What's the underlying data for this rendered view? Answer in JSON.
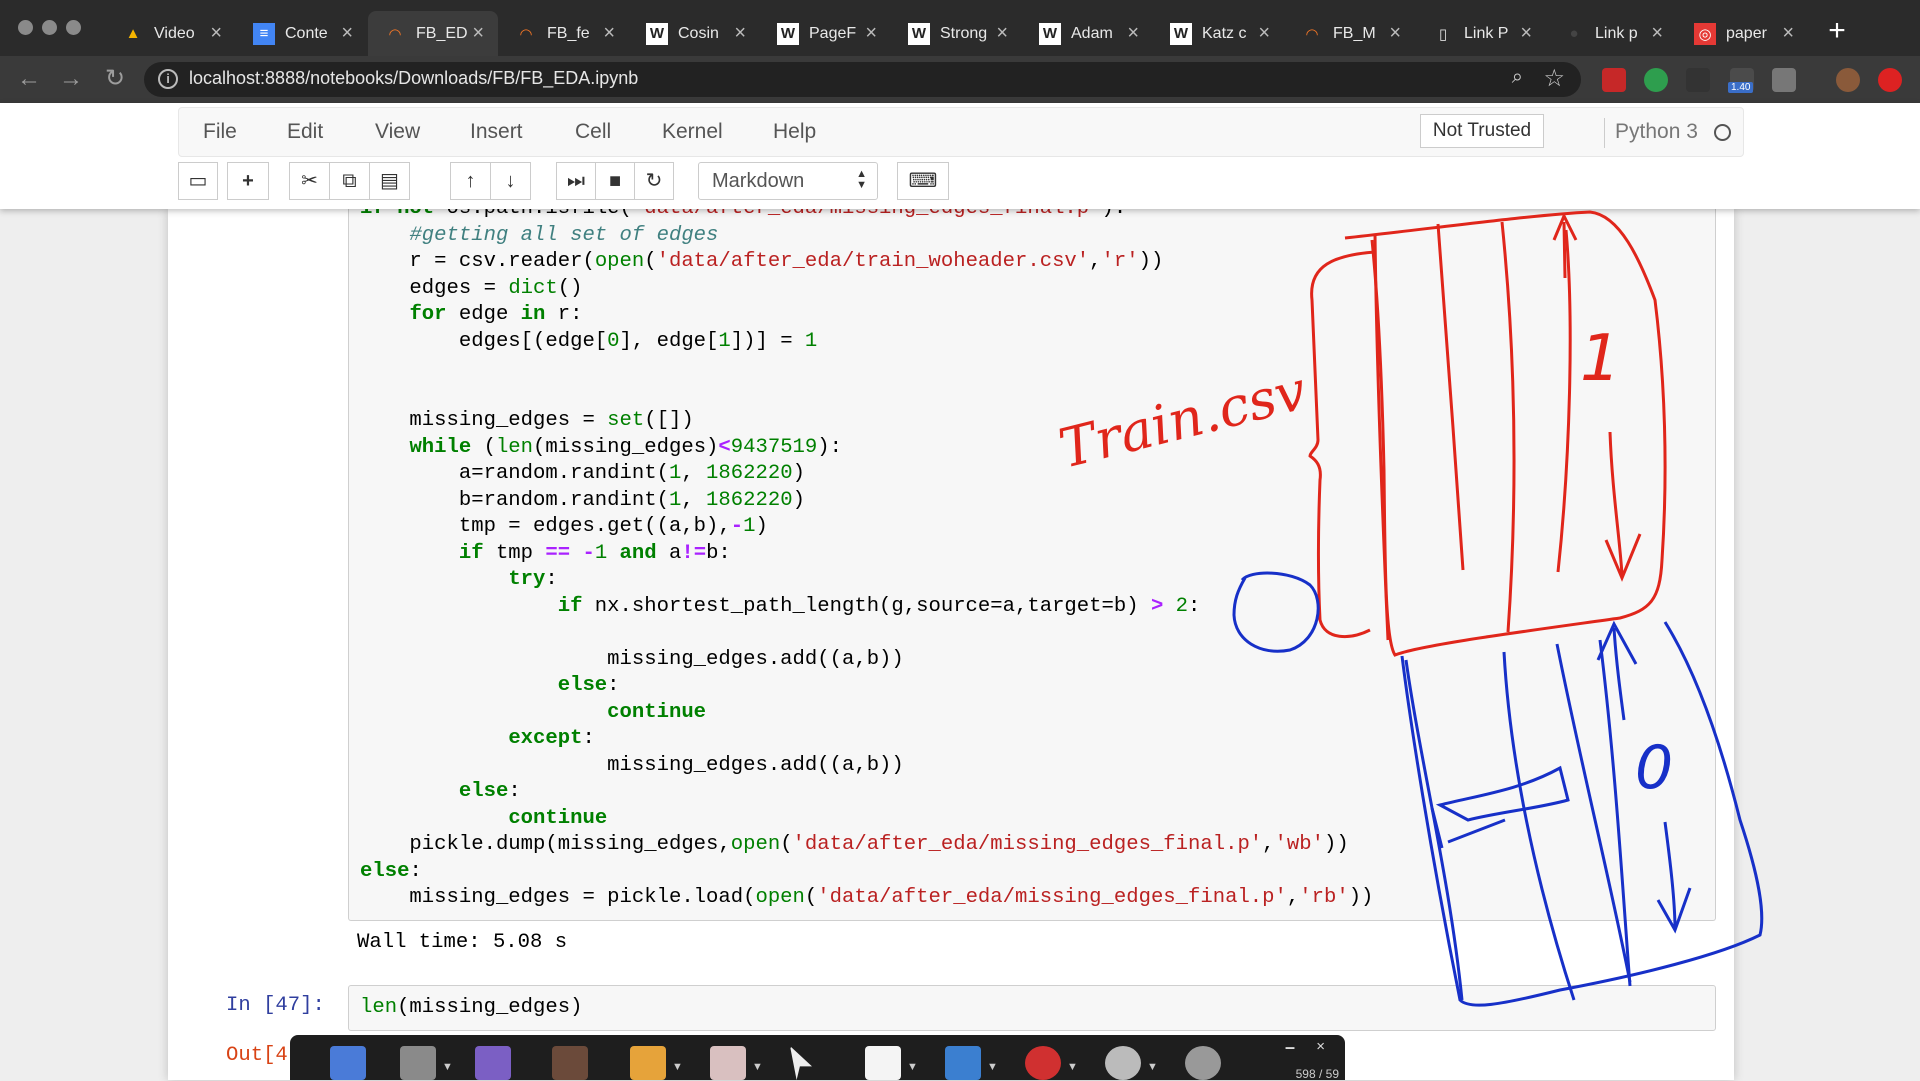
{
  "browser": {
    "tabs": [
      {
        "label": "Video",
        "icon": "google-drive-icon"
      },
      {
        "label": "Conte",
        "icon": "google-docs-icon"
      },
      {
        "label": "FB_ED",
        "icon": "jupyter-icon",
        "active": true
      },
      {
        "label": "FB_fe",
        "icon": "jupyter-icon"
      },
      {
        "label": "Cosin",
        "icon": "wikipedia-icon"
      },
      {
        "label": "PageF",
        "icon": "wikipedia-icon"
      },
      {
        "label": "Strong",
        "icon": "wikipedia-icon"
      },
      {
        "label": "Adam",
        "icon": "wikipedia-icon"
      },
      {
        "label": "Katz c",
        "icon": "wikipedia-icon"
      },
      {
        "label": "FB_M",
        "icon": "jupyter-icon"
      },
      {
        "label": "Link P",
        "icon": "document-icon"
      },
      {
        "label": "Link p",
        "icon": "github-icon"
      },
      {
        "label": "paper",
        "icon": "pdf-icon"
      }
    ],
    "tab_close_glyph": "×",
    "new_tab_glyph": "+",
    "url": "localhost:8888/notebooks/Downloads/FB/FB_EDA.ipynb",
    "extension_badge": "1.40"
  },
  "jupyter": {
    "menu": [
      "File",
      "Edit",
      "View",
      "Insert",
      "Cell",
      "Kernel",
      "Help"
    ],
    "trust_label": "Not Trusted",
    "kernel_name": "Python 3",
    "cell_type": "Markdown",
    "toolbar_icons": [
      "save-icon",
      "add-cell-icon",
      "cut-icon",
      "copy-icon",
      "paste-icon",
      "move-up-icon",
      "move-down-icon",
      "run-icon",
      "stop-icon",
      "restart-icon",
      "command-palette-icon"
    ]
  },
  "cell1": {
    "lines": [
      [
        {
          "t": "if not os.path.isfile(",
          "c": "kw-partial"
        },
        {
          "t": "'data/after_eda/missing_edges_final.p'",
          "c": "str"
        },
        {
          "t": "):",
          "c": ""
        }
      ],
      [
        {
          "t": "    ",
          "c": ""
        },
        {
          "t": "#getting all set of edges",
          "c": "com"
        }
      ],
      [
        {
          "t": "    r = csv.reader(",
          "c": ""
        },
        {
          "t": "open",
          "c": "bi"
        },
        {
          "t": "(",
          "c": ""
        },
        {
          "t": "'data/after_eda/train_woheader.csv'",
          "c": "str"
        },
        {
          "t": ",",
          "c": ""
        },
        {
          "t": "'r'",
          "c": "str"
        },
        {
          "t": "))",
          "c": ""
        }
      ],
      [
        {
          "t": "    edges = ",
          "c": ""
        },
        {
          "t": "dict",
          "c": "bi"
        },
        {
          "t": "()",
          "c": ""
        }
      ],
      [
        {
          "t": "    ",
          "c": ""
        },
        {
          "t": "for",
          "c": "kw"
        },
        {
          "t": " edge ",
          "c": ""
        },
        {
          "t": "in",
          "c": "kw"
        },
        {
          "t": " r:",
          "c": ""
        }
      ],
      [
        {
          "t": "        edges[(edge[",
          "c": ""
        },
        {
          "t": "0",
          "c": "num"
        },
        {
          "t": "], edge[",
          "c": ""
        },
        {
          "t": "1",
          "c": "num"
        },
        {
          "t": "])] = ",
          "c": ""
        },
        {
          "t": "1",
          "c": "num"
        }
      ],
      [],
      [],
      [
        {
          "t": "    missing_edges = ",
          "c": ""
        },
        {
          "t": "set",
          "c": "bi"
        },
        {
          "t": "([])",
          "c": ""
        }
      ],
      [
        {
          "t": "    ",
          "c": ""
        },
        {
          "t": "while",
          "c": "kw"
        },
        {
          "t": " (",
          "c": ""
        },
        {
          "t": "len",
          "c": "bi"
        },
        {
          "t": "(missing_edges)",
          "c": ""
        },
        {
          "t": "<",
          "c": "op"
        },
        {
          "t": "9437519",
          "c": "num"
        },
        {
          "t": "):",
          "c": ""
        }
      ],
      [
        {
          "t": "        a=random.randint(",
          "c": ""
        },
        {
          "t": "1",
          "c": "num"
        },
        {
          "t": ", ",
          "c": ""
        },
        {
          "t": "1862220",
          "c": "num"
        },
        {
          "t": ")",
          "c": ""
        }
      ],
      [
        {
          "t": "        b=random.randint(",
          "c": ""
        },
        {
          "t": "1",
          "c": "num"
        },
        {
          "t": ", ",
          "c": ""
        },
        {
          "t": "1862220",
          "c": "num"
        },
        {
          "t": ")",
          "c": ""
        }
      ],
      [
        {
          "t": "        tmp = edges.get((a,b),",
          "c": ""
        },
        {
          "t": "-",
          "c": "op"
        },
        {
          "t": "1",
          "c": "num"
        },
        {
          "t": ")",
          "c": ""
        }
      ],
      [
        {
          "t": "        ",
          "c": ""
        },
        {
          "t": "if",
          "c": "kw"
        },
        {
          "t": " tmp ",
          "c": ""
        },
        {
          "t": "==",
          "c": "op"
        },
        {
          "t": " ",
          "c": ""
        },
        {
          "t": "-",
          "c": "op"
        },
        {
          "t": "1",
          "c": "num"
        },
        {
          "t": " ",
          "c": ""
        },
        {
          "t": "and",
          "c": "kw"
        },
        {
          "t": " a",
          "c": ""
        },
        {
          "t": "!=",
          "c": "op"
        },
        {
          "t": "b:",
          "c": ""
        }
      ],
      [
        {
          "t": "            ",
          "c": ""
        },
        {
          "t": "try",
          "c": "kw"
        },
        {
          "t": ":",
          "c": ""
        }
      ],
      [
        {
          "t": "                ",
          "c": ""
        },
        {
          "t": "if",
          "c": "kw"
        },
        {
          "t": " nx.shortest_path_length(g,source=a,target=b) ",
          "c": ""
        },
        {
          "t": ">",
          "c": "op"
        },
        {
          "t": " ",
          "c": ""
        },
        {
          "t": "2",
          "c": "num"
        },
        {
          "t": ":",
          "c": ""
        }
      ],
      [],
      [
        {
          "t": "                    missing_edges.add((a,b))",
          "c": ""
        }
      ],
      [
        {
          "t": "                ",
          "c": ""
        },
        {
          "t": "else",
          "c": "kw"
        },
        {
          "t": ":",
          "c": ""
        }
      ],
      [
        {
          "t": "                    ",
          "c": ""
        },
        {
          "t": "continue",
          "c": "kw"
        }
      ],
      [
        {
          "t": "            ",
          "c": ""
        },
        {
          "t": "except",
          "c": "kw"
        },
        {
          "t": ":",
          "c": ""
        }
      ],
      [
        {
          "t": "                    missing_edges.add((a,b))",
          "c": ""
        }
      ],
      [
        {
          "t": "        ",
          "c": ""
        },
        {
          "t": "else",
          "c": "kw"
        },
        {
          "t": ":",
          "c": ""
        }
      ],
      [
        {
          "t": "            ",
          "c": ""
        },
        {
          "t": "continue",
          "c": "kw"
        }
      ],
      [
        {
          "t": "    pickle.dump(missing_edges,",
          "c": ""
        },
        {
          "t": "open",
          "c": "bi"
        },
        {
          "t": "(",
          "c": ""
        },
        {
          "t": "'data/after_eda/missing_edges_final.p'",
          "c": "str"
        },
        {
          "t": ",",
          "c": ""
        },
        {
          "t": "'wb'",
          "c": "str"
        },
        {
          "t": "))",
          "c": ""
        }
      ],
      [
        {
          "t": "else",
          "c": "kw"
        },
        {
          "t": ":",
          "c": ""
        }
      ],
      [
        {
          "t": "    missing_edges = pickle.load(",
          "c": ""
        },
        {
          "t": "open",
          "c": "bi"
        },
        {
          "t": "(",
          "c": ""
        },
        {
          "t": "'data/after_eda/missing_edges_final.p'",
          "c": "str"
        },
        {
          "t": ",",
          "c": ""
        },
        {
          "t": "'rb'",
          "c": "str"
        },
        {
          "t": "))",
          "c": ""
        }
      ]
    ],
    "output": "Wall time: 5.08 s"
  },
  "cell2": {
    "prompt": "In [47]:",
    "code": [
      {
        "t": "len",
        "c": "bi"
      },
      {
        "t": "(missing_edges)",
        "c": ""
      }
    ],
    "out_prompt": "Out[4"
  },
  "annotations": {
    "handwritten_label": "Train.csv",
    "red_label": "1",
    "blue_label": "0"
  },
  "draw_toolbar": {
    "tools": [
      "pointer-star-icon",
      "slide-icon",
      "highlighter-icon",
      "marker-icon",
      "pen-icon",
      "eraser-icon",
      "cursor-icon",
      "whiteboard-icon",
      "line-tool-icon",
      "record-icon",
      "webcam-icon",
      "settings-icon"
    ],
    "minimize_glyph": "–",
    "close_glyph": "×",
    "counter": "598 / 59"
  },
  "colors": {
    "annotation_red": "#e0261b",
    "annotation_blue": "#1730c8",
    "keyword_green": "#008000",
    "string_red": "#ba2121"
  }
}
